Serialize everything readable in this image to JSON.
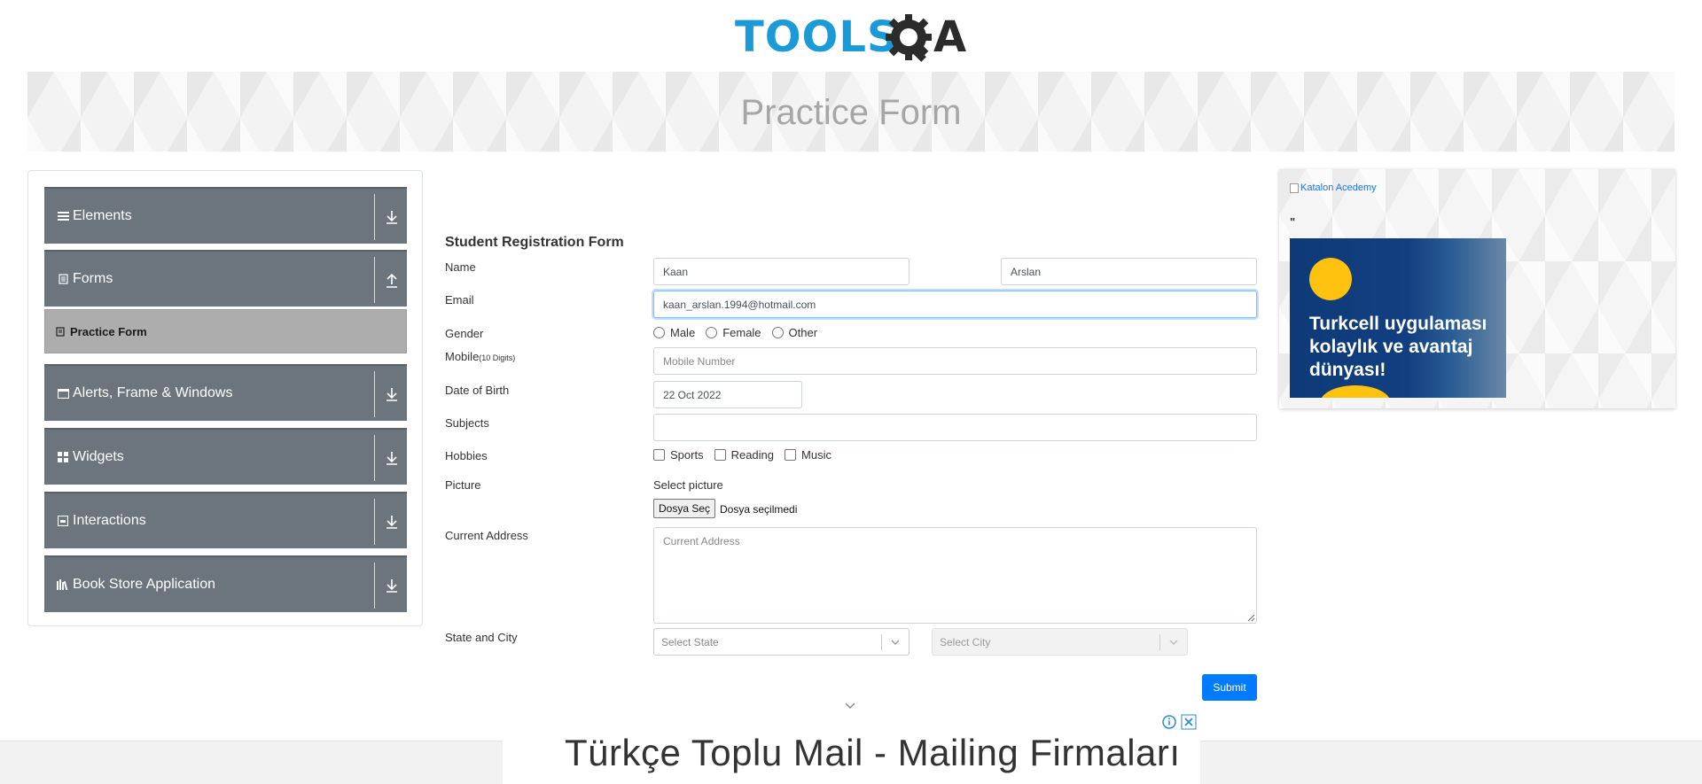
{
  "header": {
    "logo_primary": "TOOLS",
    "logo_secondary": "A"
  },
  "banner": {
    "title": "Practice Form"
  },
  "sidebar": {
    "groups": [
      {
        "label": "Elements",
        "icon": "hamburger-icon",
        "expanded": false
      },
      {
        "label": "Forms",
        "icon": "document-icon",
        "expanded": true
      },
      {
        "label": "Alerts, Frame & Windows",
        "icon": "window-icon",
        "expanded": false
      },
      {
        "label": "Widgets",
        "icon": "grid-icon",
        "expanded": false
      },
      {
        "label": "Interactions",
        "icon": "interaction-icon",
        "expanded": false
      },
      {
        "label": "Book Store Application",
        "icon": "books-icon",
        "expanded": false
      }
    ],
    "active_item": {
      "label": "Practice Form",
      "icon": "file-icon"
    }
  },
  "form": {
    "title": "Student Registration Form",
    "labels": {
      "name": "Name",
      "email": "Email",
      "gender": "Gender",
      "mobile": "Mobile",
      "mobile_hint": "(10 Digits)",
      "dob": "Date of Birth",
      "subjects": "Subjects",
      "hobbies": "Hobbies",
      "picture": "Picture",
      "address": "Current Address",
      "state_city": "State and City"
    },
    "first_name": "Kaan",
    "last_name": "Arslan",
    "email": "kaan_arslan.1994@hotmail.com",
    "gender_options": [
      "Male",
      "Female",
      "Other"
    ],
    "mobile_placeholder": "Mobile Number",
    "dob": "22 Oct 2022",
    "subjects": "",
    "hobby_options": [
      "Sports",
      "Reading",
      "Music"
    ],
    "picture_label": "Select picture",
    "file_button": "Dosya Seç",
    "file_status": "Dosya seçilmedi",
    "address_placeholder": "Current Address",
    "state_placeholder": "Select State",
    "city_placeholder": "Select City",
    "submit": "Submit"
  },
  "right_ad": {
    "link_text": "Katalon Acedemy",
    "quotes": "\"",
    "image_text": [
      "Turkcell uygulaması",
      "kolaylık ve avantaj",
      "dünyası!"
    ]
  },
  "bottom_ad": {
    "text": "Türkçe Toplu Mail - Mailing Firmaları"
  },
  "colors": {
    "accent": "#007bff",
    "sidebar": "#6c757d",
    "logo_blue": "#1a9ad6"
  }
}
